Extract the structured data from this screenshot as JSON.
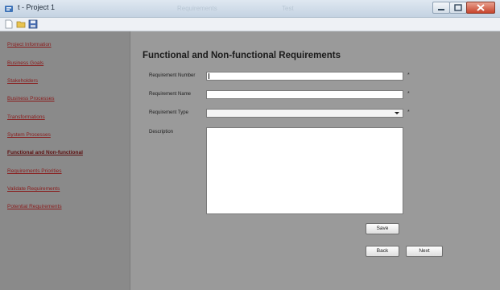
{
  "window": {
    "title": "t - Project 1",
    "ghost_title_fragments": [
      "Requirements",
      "Test"
    ]
  },
  "toolbar": {
    "icons": [
      "new-document-icon",
      "open-folder-icon",
      "save-disk-icon"
    ]
  },
  "sidebar": {
    "items": [
      {
        "label": "Project Information",
        "active": false
      },
      {
        "label": "Business Goals",
        "active": false
      },
      {
        "label": "Stakeholders",
        "active": false
      },
      {
        "label": "Business Processes",
        "active": false
      },
      {
        "label": "Transformations",
        "active": false
      },
      {
        "label": "System Processes",
        "active": false
      },
      {
        "label": "Functional and Non-functional",
        "active": true
      },
      {
        "label": "Requirements Priorities",
        "active": false
      },
      {
        "label": "Validate Requirements",
        "active": false
      },
      {
        "label": "Potential Requirements",
        "active": false
      }
    ]
  },
  "form": {
    "title": "Functional and Non-functional Requirements",
    "requirement_number": {
      "label": "Requirement Number",
      "value": "",
      "required_mark": "*"
    },
    "requirement_name": {
      "label": "Requirement Name",
      "value": "",
      "required_mark": "*"
    },
    "requirement_type": {
      "label": "Requirement Type",
      "value": "",
      "required_mark": "*"
    },
    "description": {
      "label": "Description",
      "value": ""
    }
  },
  "buttons": {
    "save": "Save",
    "back": "Back",
    "next": "Next"
  },
  "colors": {
    "sidebar_bg": "#8a8a8a",
    "main_bg": "#9a9a9a",
    "link": "#8a1b1b",
    "active_link": "#5c0f0f"
  }
}
